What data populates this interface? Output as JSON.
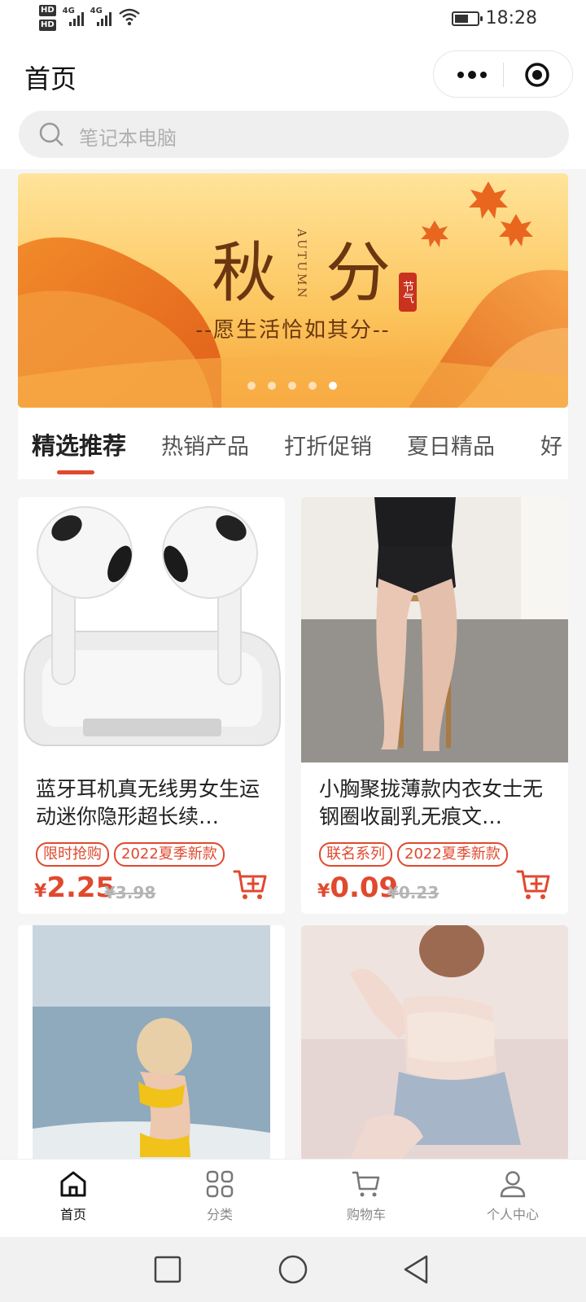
{
  "status_bar": {
    "hd1": "HD",
    "hd2": "HD",
    "net1": "4G",
    "net2": "4G",
    "time": "18:28"
  },
  "header": {
    "title": "首页"
  },
  "search": {
    "placeholder": "笔记本电脑"
  },
  "banner": {
    "title_left": "秋",
    "title_right": "分",
    "en": "AUTUMN",
    "seal": "节气",
    "subtitle": "--愿生活恰如其分--",
    "slide_count": 5,
    "active_slide": 5
  },
  "tabs": [
    {
      "label": "精选推荐",
      "active": true
    },
    {
      "label": "热销产品"
    },
    {
      "label": "打折促销"
    },
    {
      "label": "夏日精品"
    },
    {
      "label": "好"
    }
  ],
  "products": [
    {
      "title": "蓝牙耳机真无线男女生运动迷你隐形超长续…",
      "tags": [
        "限时抢购",
        "2022夏季新款"
      ],
      "price_symbol": "¥",
      "price": "2.25",
      "original_price": "¥3.98"
    },
    {
      "title": "小胸聚拢薄款内衣女士无钢圈收副乳无痕文…",
      "tags": [
        "联名系列",
        "2022夏季新款"
      ],
      "price_symbol": "¥",
      "price": "0.09",
      "original_price": "¥0.23"
    }
  ],
  "bottom_nav": [
    {
      "label": "首页",
      "icon": "home-icon",
      "active": true
    },
    {
      "label": "分类",
      "icon": "category-icon"
    },
    {
      "label": "购物车",
      "icon": "cart-icon"
    },
    {
      "label": "个人中心",
      "icon": "user-icon"
    }
  ],
  "colors": {
    "accent": "#e0492e",
    "banner_text": "#6b3610"
  }
}
